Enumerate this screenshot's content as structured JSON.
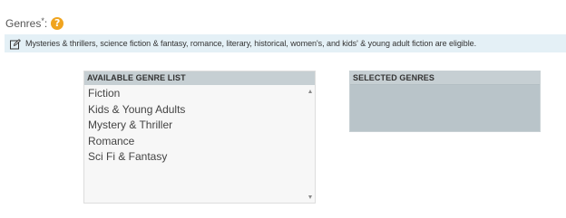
{
  "genres": {
    "label": "Genres",
    "required_marker": "*",
    "colon": ":",
    "help_icon": "help-icon",
    "help_symbol": "?",
    "info_text": "Mysteries & thrillers, science fiction & fantasy, romance, literary, historical, women's, and kids' & young adult fiction are eligible.",
    "info_icon": "edit-icon"
  },
  "available": {
    "header": "AVAILABLE GENRE LIST",
    "items": [
      "Fiction",
      "Kids & Young Adults",
      "Mystery & Thriller",
      "Romance",
      "Sci Fi & Fantasy"
    ]
  },
  "selected": {
    "header": "SELECTED GENRES",
    "items": []
  },
  "colors": {
    "help_icon": "#f0a41f",
    "info_bar_bg": "#e4f0f6",
    "panel_header_bg": "#c6cfd3",
    "selected_panel_bg": "#b9c4c9"
  }
}
